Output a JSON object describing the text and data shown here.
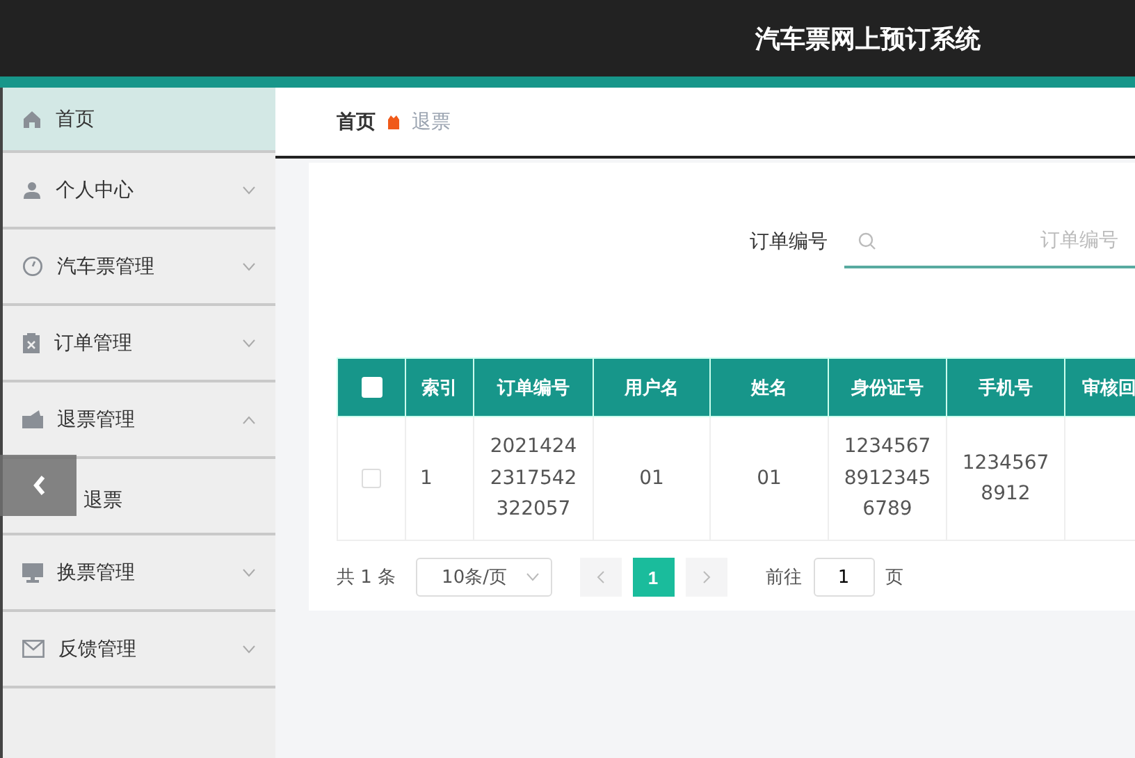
{
  "header": {
    "title": "汽车票网上预订系统"
  },
  "sidebar": {
    "items": [
      {
        "label": "首页",
        "selected": true,
        "expanded": false,
        "expandable": false
      },
      {
        "label": "个人中心",
        "selected": false,
        "expanded": false,
        "expandable": true
      },
      {
        "label": "汽车票管理",
        "selected": false,
        "expanded": false,
        "expandable": true
      },
      {
        "label": "订单管理",
        "selected": false,
        "expanded": false,
        "expandable": true
      },
      {
        "label": "退票管理",
        "selected": false,
        "expanded": true,
        "expandable": true,
        "children": [
          {
            "label": "退票",
            "selected": false
          }
        ]
      },
      {
        "label": "换票管理",
        "selected": false,
        "expanded": false,
        "expandable": true
      },
      {
        "label": "反馈管理",
        "selected": false,
        "expanded": false,
        "expandable": true
      }
    ]
  },
  "breadcrumb": [
    {
      "label": "首页"
    },
    {
      "label": "退票"
    }
  ],
  "search": {
    "label": "订单编号",
    "placeholder": "订单编号"
  },
  "table": {
    "select_all_checked": false,
    "columns": [
      "索引",
      "订单编号",
      "用户名",
      "姓名",
      "身份证号",
      "手机号",
      "审核回"
    ],
    "rows": [
      {
        "checked": false,
        "cells": [
          "1",
          "2021424\n2317542\n322057",
          "01",
          "01",
          "1234567\n8912345\n6789",
          "1234567\n8912",
          ""
        ]
      }
    ]
  },
  "pagination": {
    "total": "共 1 条",
    "page_size": "10条/页",
    "pages": [
      {
        "label": "1",
        "selected": true
      }
    ],
    "goto_label": "前往",
    "goto_value": "1",
    "goto_unit": "页"
  }
}
